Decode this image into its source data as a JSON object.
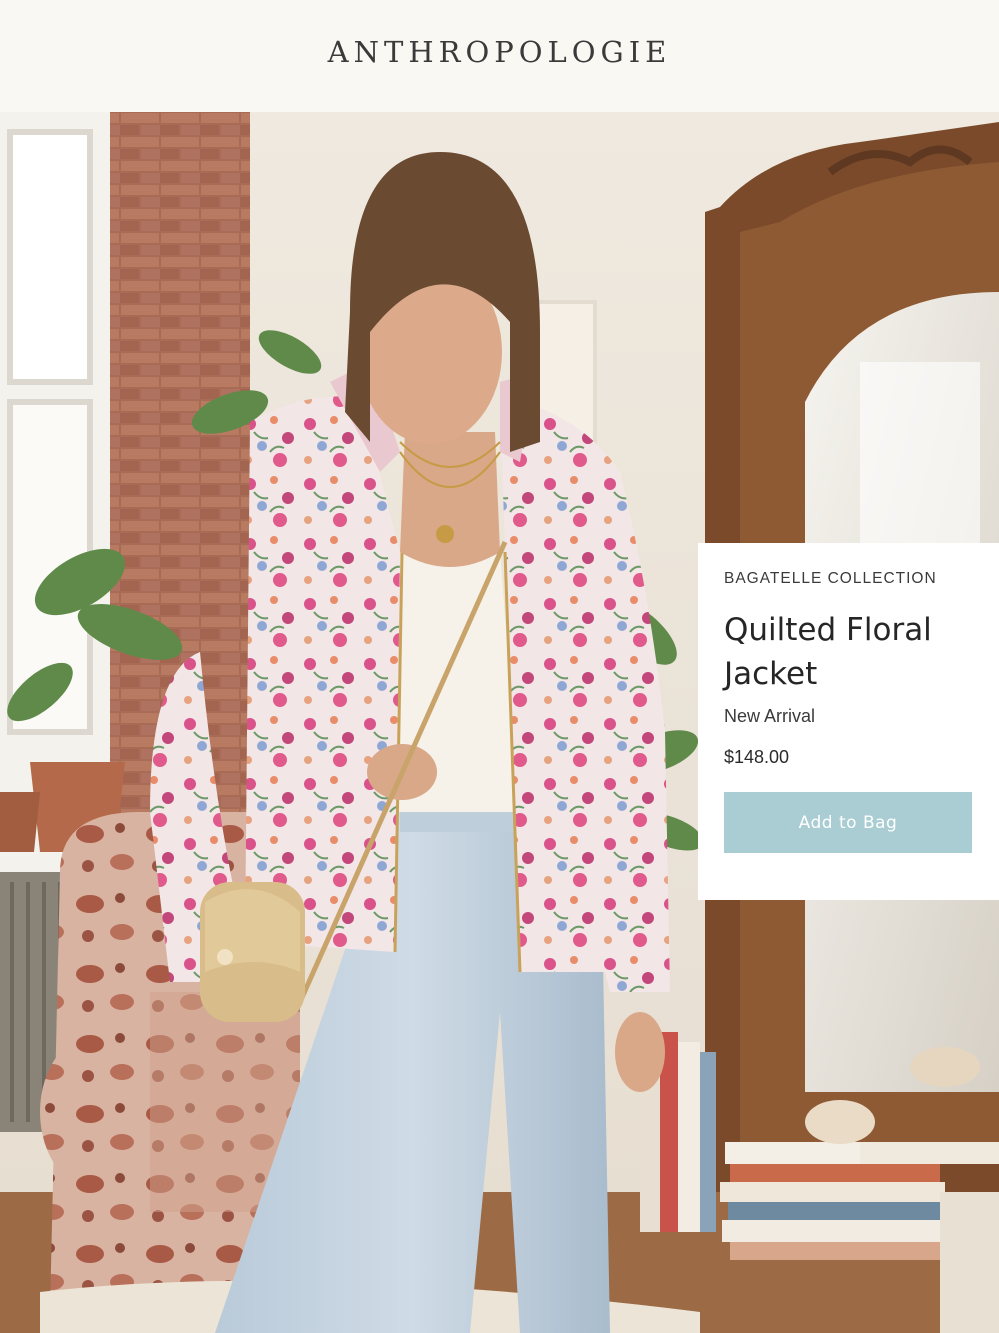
{
  "brand": {
    "logo_text": "ANTHROPOLOGIE"
  },
  "product": {
    "collection": "BAGATELLE COLLECTION",
    "title_line1": "Quilted Floral",
    "title_line2": "Jacket",
    "badge": "New Arrival",
    "price": "$148.00",
    "add_to_bag_label": "Add to Bag"
  },
  "hero_image": {
    "icon": "lifestyle-photo",
    "description_hidden": ""
  },
  "colors": {
    "header_bg": "#faf8f3",
    "button_bg": "#a9cdd2",
    "card_bg": "#ffffff"
  }
}
